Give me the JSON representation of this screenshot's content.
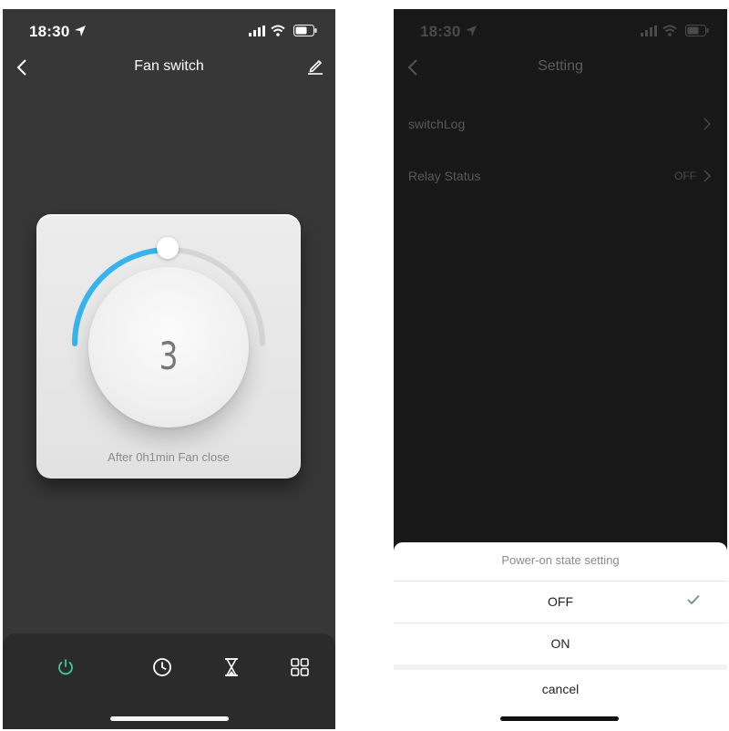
{
  "left_screen": {
    "status_time": "18:30",
    "title": "Fan switch",
    "dial_value": "3",
    "caption": "After 0h1min Fan close",
    "accent_color": "#37b4ee",
    "power_color": "#3dc9a0",
    "tabs": [
      "power-icon",
      "clock-icon",
      "hourglass-icon",
      "grid-icon"
    ]
  },
  "right_screen": {
    "status_time": "18:30",
    "title": "Setting",
    "rows": [
      {
        "label": "switchLog",
        "value": ""
      },
      {
        "label": "Relay Status",
        "value": "OFF"
      }
    ],
    "sheet": {
      "title": "Power-on state setting",
      "options": [
        "OFF",
        "ON"
      ],
      "selected": "OFF",
      "cancel": "cancel"
    }
  }
}
